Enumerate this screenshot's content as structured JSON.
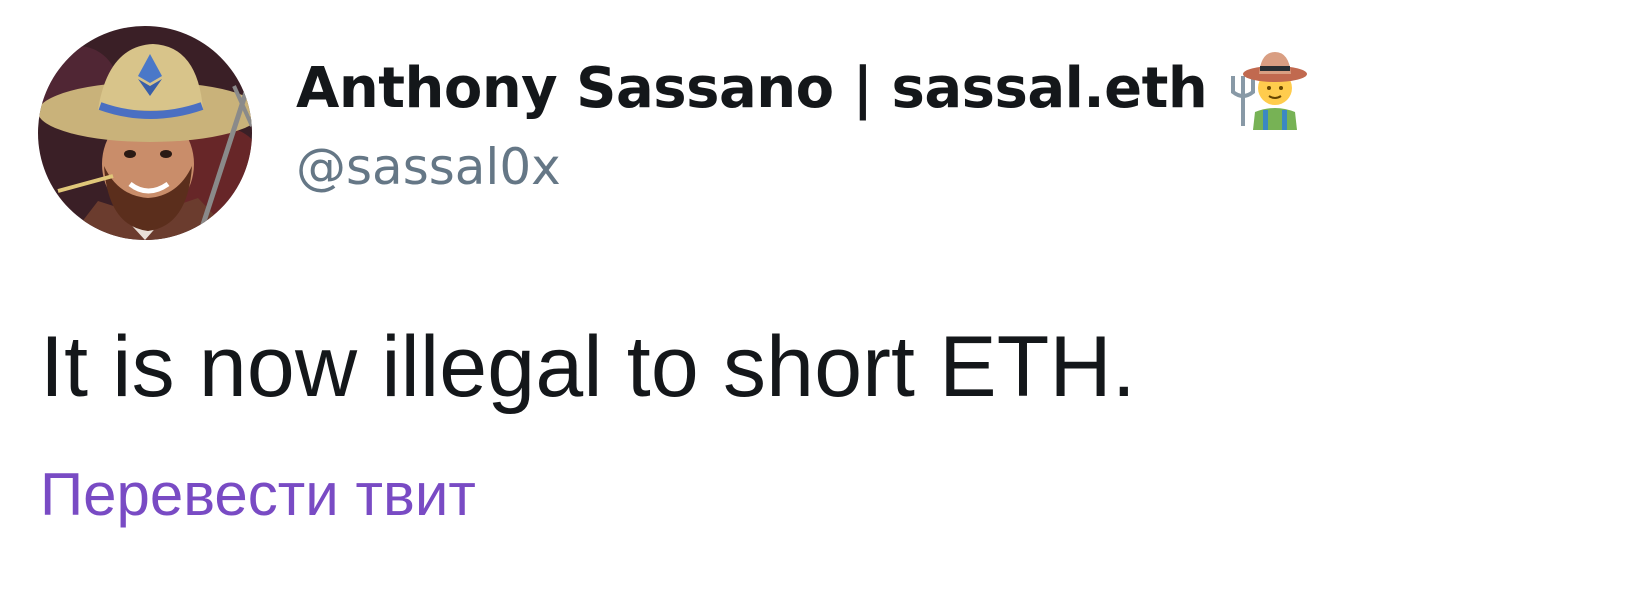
{
  "tweet": {
    "author": {
      "display_name": "Anthony Sassano | sassal.eth",
      "name_emoji": "farmer-icon",
      "handle": "@sassal0x",
      "avatar": "avatar-photo"
    },
    "text": "It is now illegal to short ETH.",
    "translate_label": "Перевести твит"
  },
  "colors": {
    "text_primary": "#14171a",
    "text_secondary": "#657786",
    "translate_link": "#794bc4",
    "background": "#ffffff"
  }
}
